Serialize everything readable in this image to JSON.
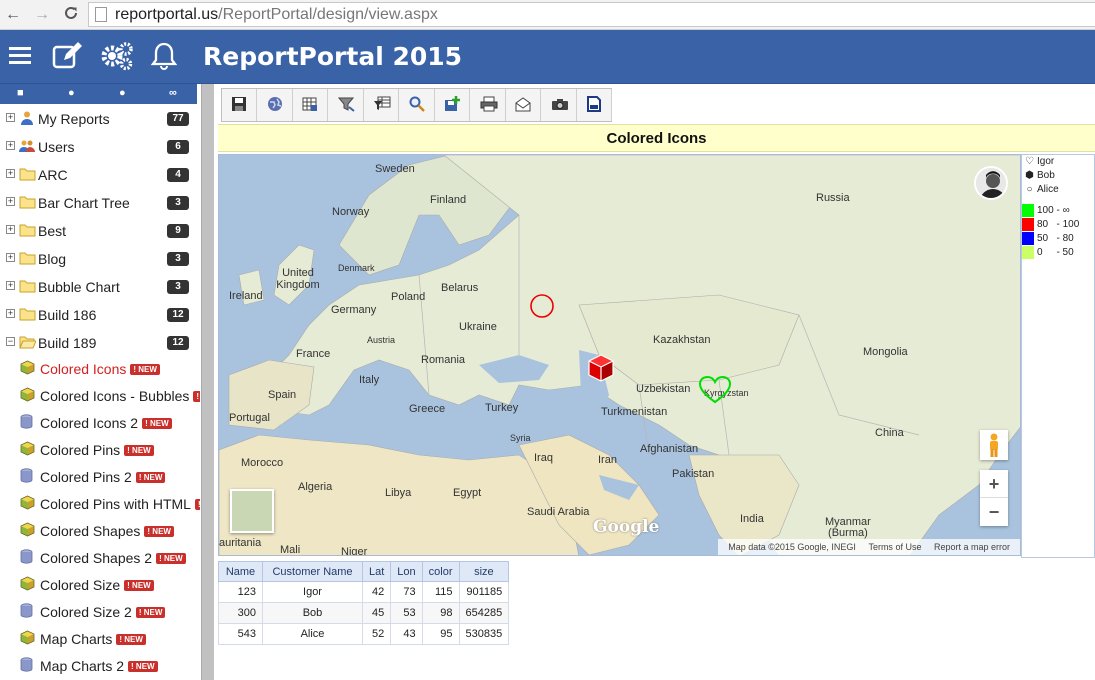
{
  "browser": {
    "url_host": "reportportal.us",
    "url_path": "/ReportPortal/design/view.aspx"
  },
  "header": {
    "title": "ReportPortal 2015",
    "icons": [
      "menu-icon",
      "edit-icon",
      "settings-icon",
      "notifications-icon"
    ]
  },
  "sidebar": {
    "toolbar_icons": [
      "folder-icon",
      "add-icon",
      "remove-icon",
      "binoculars-icon"
    ],
    "tree": [
      {
        "label": "My Reports",
        "count": "77",
        "icon": "user-icon"
      },
      {
        "label": "Users",
        "count": "6",
        "icon": "users-icon"
      },
      {
        "label": "ARC",
        "count": "4",
        "icon": "folder-icon"
      },
      {
        "label": "Bar Chart Tree",
        "count": "3",
        "icon": "folder-icon"
      },
      {
        "label": "Best",
        "count": "9",
        "icon": "folder-icon"
      },
      {
        "label": "Blog",
        "count": "3",
        "icon": "folder-icon"
      },
      {
        "label": "Bubble Chart",
        "count": "3",
        "icon": "folder-icon"
      },
      {
        "label": "Build 186",
        "count": "12",
        "icon": "folder-icon"
      },
      {
        "label": "Build 189",
        "count": "12",
        "icon": "folder-open-icon"
      }
    ],
    "reports": [
      {
        "label": "Colored Icons",
        "badge": "! NEW",
        "icon": "cube-icon",
        "active": true
      },
      {
        "label": "Colored Icons - Bubbles",
        "badge": "! NEW",
        "icon": "cube-icon"
      },
      {
        "label": "Colored Icons 2",
        "badge": "! NEW",
        "icon": "database-icon"
      },
      {
        "label": "Colored Pins",
        "badge": "! NEW",
        "icon": "cube-icon"
      },
      {
        "label": "Colored Pins 2",
        "badge": "! NEW",
        "icon": "database-icon"
      },
      {
        "label": "Colored Pins with HTML",
        "badge": "! NEW",
        "icon": "cube-icon"
      },
      {
        "label": "Colored Shapes",
        "badge": "! NEW",
        "icon": "cube-icon"
      },
      {
        "label": "Colored Shapes 2",
        "badge": "! NEW",
        "icon": "database-icon"
      },
      {
        "label": "Colored Size",
        "badge": "! NEW",
        "icon": "cube-icon"
      },
      {
        "label": "Colored Size 2",
        "badge": "! NEW",
        "icon": "database-icon"
      },
      {
        "label": "Map Charts",
        "badge": "! NEW",
        "icon": "cube-icon"
      },
      {
        "label": "Map Charts 2",
        "badge": "! NEW",
        "icon": "database-icon"
      }
    ]
  },
  "toolbar": {
    "buttons": [
      "save-icon",
      "globe-icon",
      "grid-icon",
      "filter-icon",
      "filter-table-icon",
      "search-icon",
      "export-icon",
      "print-icon",
      "email-icon",
      "camera-icon",
      "document-icon"
    ]
  },
  "report": {
    "title": "Colored Icons"
  },
  "map": {
    "countries": {
      "sweden": "Sweden",
      "finland": "Finland",
      "norway": "Norway",
      "denmark": "Denmark",
      "russia": "Russia",
      "uk": "United Kingdom",
      "ireland": "Ireland",
      "belarus": "Belarus",
      "poland": "Poland",
      "germany": "Germany",
      "ukraine": "Ukraine",
      "austria": "Austria",
      "france": "France",
      "romania": "Romania",
      "italy": "Italy",
      "spain": "Spain",
      "portugal": "Portugal",
      "greece": "Greece",
      "turkey": "Turkey",
      "kazakhstan": "Kazakhstan",
      "mongolia": "Mongolia",
      "uzbekistan": "Uzbekistan",
      "kyrgyzstan": "Kyrgyzstan",
      "turkmenistan": "Turkmenistan",
      "syria": "Syria",
      "iraq": "Iraq",
      "iran": "Iran",
      "afghanistan": "Afghanistan",
      "pakistan": "Pakistan",
      "china": "China",
      "morocco": "Morocco",
      "algeria": "Algeria",
      "libya": "Libya",
      "egypt": "Egypt",
      "saudi": "Saudi Arabia",
      "india": "India",
      "myanmar": "Myanmar\n(Burma)",
      "mali": "Mali",
      "niger": "Niger",
      "mauritania": "auritania"
    },
    "google_logo": "Google",
    "attribution": [
      "Map data ©2015 Google, INEGI",
      "Terms of Use",
      "Report a map error"
    ],
    "zoom_in": "+",
    "zoom_out": "−",
    "markers": [
      {
        "name": "Igor",
        "shape": "heart",
        "color": "#00e000"
      },
      {
        "name": "Bob",
        "shape": "cube",
        "color": "#ee0000"
      },
      {
        "name": "Alice",
        "shape": "circle",
        "color": "#ee0000"
      }
    ]
  },
  "legend": {
    "shapes": [
      {
        "symbol": "♡",
        "name": "Igor"
      },
      {
        "symbol": "⬢",
        "name": "Bob"
      },
      {
        "symbol": "○",
        "name": "Alice"
      }
    ],
    "ranges": [
      {
        "color": "#00ff00",
        "label": "100 - ∞"
      },
      {
        "color": "#ff0000",
        "label": "80   - 100"
      },
      {
        "color": "#0000ff",
        "label": "50   - 80"
      },
      {
        "color": "#ccff66",
        "label": "0     - 50"
      }
    ]
  },
  "table": {
    "headers": [
      "Name",
      "Customer Name",
      "Lat",
      "Lon",
      "color",
      "size"
    ],
    "rows": [
      [
        "123",
        "Igor",
        "42",
        "73",
        "115",
        "901185"
      ],
      [
        "300",
        "Bob",
        "45",
        "53",
        "98",
        "654285"
      ],
      [
        "543",
        "Alice",
        "52",
        "43",
        "95",
        "530835"
      ]
    ]
  }
}
